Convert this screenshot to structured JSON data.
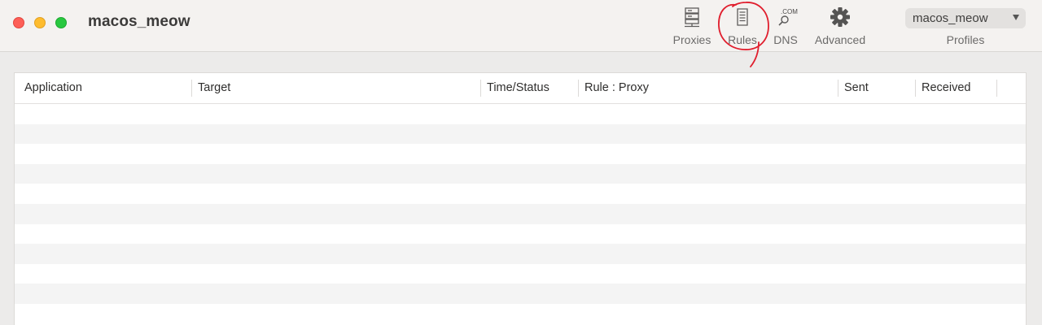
{
  "window": {
    "title": "macos_meow"
  },
  "toolbar": {
    "items": [
      {
        "label": "Proxies",
        "icon": "server-icon"
      },
      {
        "label": "Rules",
        "icon": "document-icon"
      },
      {
        "label": "DNS",
        "icon": "dns-search-icon",
        "icon_text": ".COM"
      },
      {
        "label": "Advanced",
        "icon": "gear-icon"
      }
    ],
    "profile": {
      "selected": "macos_meow",
      "caption": "Profiles"
    }
  },
  "table": {
    "columns": [
      "Application",
      "Target",
      "Time/Status",
      "Rule : Proxy",
      "Sent",
      "Received"
    ],
    "rows": []
  },
  "colors": {
    "close": "#fd5f57",
    "minimize": "#febc2e",
    "maximize": "#28c840",
    "annotation": "#e01e2d"
  }
}
